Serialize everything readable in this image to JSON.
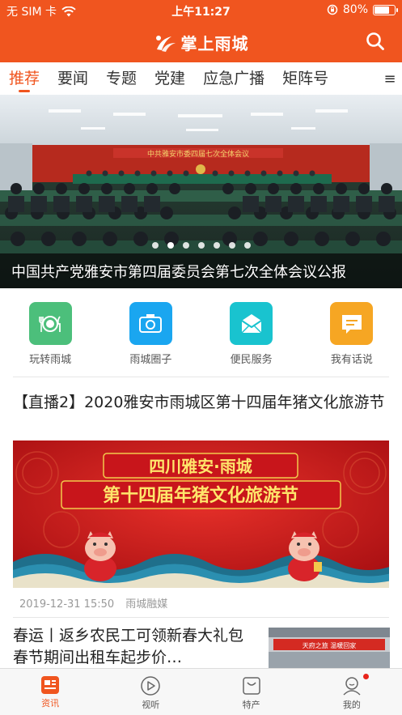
{
  "status_bar": {
    "carrier": "无 SIM 卡",
    "time": "上午11:27",
    "battery": "80%",
    "battery_level": 0.8
  },
  "header": {
    "app_title": "掌上雨城",
    "brand_color": "#f0551f"
  },
  "tabs": [
    {
      "label": "推荐",
      "active": true
    },
    {
      "label": "要闻"
    },
    {
      "label": "专题"
    },
    {
      "label": "党建"
    },
    {
      "label": "应急广播"
    },
    {
      "label": "矩阵号"
    }
  ],
  "tabs_menu_icon": "≡",
  "banner": {
    "caption": "中国共产党雅安市第四届委员会第七次全体会议公报",
    "slide_count": 7,
    "active_slide": 1,
    "stage_banner_text": "中共雅安市委四届七次全体会议"
  },
  "quick_actions": [
    {
      "label": "玩转雨城",
      "icon": "dining-icon",
      "color": "#4cbf7b"
    },
    {
      "label": "雨城圈子",
      "icon": "camera-icon",
      "color": "#1aa6f0"
    },
    {
      "label": "便民服务",
      "icon": "mail-icon",
      "color": "#19c3cf"
    },
    {
      "label": "我有话说",
      "icon": "chat-icon",
      "color": "#f6a623"
    }
  ],
  "articles": [
    {
      "title": "【直播2】2020雅安市雨城区第十四届年猪文化旅游节",
      "image_line1": "四川雅安·雨城",
      "image_line2": "第十四届年猪文化旅游节",
      "time": "2019-12-31 15:50",
      "source": "雨城融媒"
    },
    {
      "title": "春运丨返乡农民工可领新春大礼包 春节期间出租车起步价…",
      "thumb_text": "天府之旅 温暖回家"
    }
  ],
  "bottom_nav": [
    {
      "label": "资讯",
      "icon": "news-icon",
      "active": true
    },
    {
      "label": "视听",
      "icon": "play-icon"
    },
    {
      "label": "特产",
      "icon": "bag-icon"
    },
    {
      "label": "我的",
      "icon": "user-icon",
      "badge": true
    }
  ]
}
